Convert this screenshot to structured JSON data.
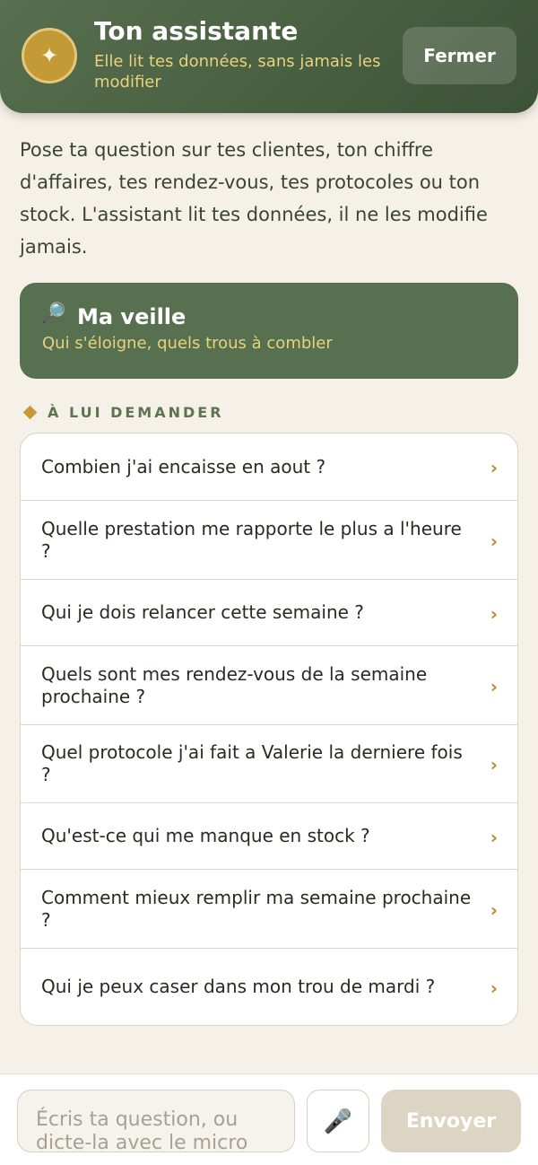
{
  "header": {
    "avatar_glyph": "✦",
    "title": "Ton assistante",
    "subtitle": "Elle lit tes données, sans jamais les modifier",
    "close_label": "Fermer"
  },
  "intro": "Pose ta question sur tes clientes, ton chiffre d'affaires, tes rendez-vous, tes protocoles ou ton stock. L'assistant lit tes données, il ne les modifie jamais.",
  "veille": {
    "icon": "🔎",
    "title": "Ma veille",
    "subtitle": "Qui s'éloigne, quels trous à combler"
  },
  "section_label": "À LUI DEMANDER",
  "suggestions": [
    "Combien j'ai encaisse en aout ?",
    "Quelle prestation me rapporte le plus a l'heure ?",
    "Qui je dois relancer cette semaine ?",
    "Quels sont mes rendez-vous de la semaine prochaine ?",
    "Quel protocole j'ai fait a Valerie la derniere fois ?",
    "Qu'est-ce qui me manque en stock ?",
    "Comment mieux remplir ma semaine prochaine ?",
    "Qui je peux caser dans mon trou de mardi ?"
  ],
  "chevron": "›",
  "composer": {
    "placeholder": "Écris ta question, ou dicte-la avec le micro",
    "mic_icon": "🎤",
    "send_label": "Envoyer"
  },
  "colors": {
    "header_green": "#4b6243",
    "card_green": "#577050",
    "gold": "#c39a35",
    "gold_text": "#e7d27f",
    "background": "#f5f1e8"
  }
}
